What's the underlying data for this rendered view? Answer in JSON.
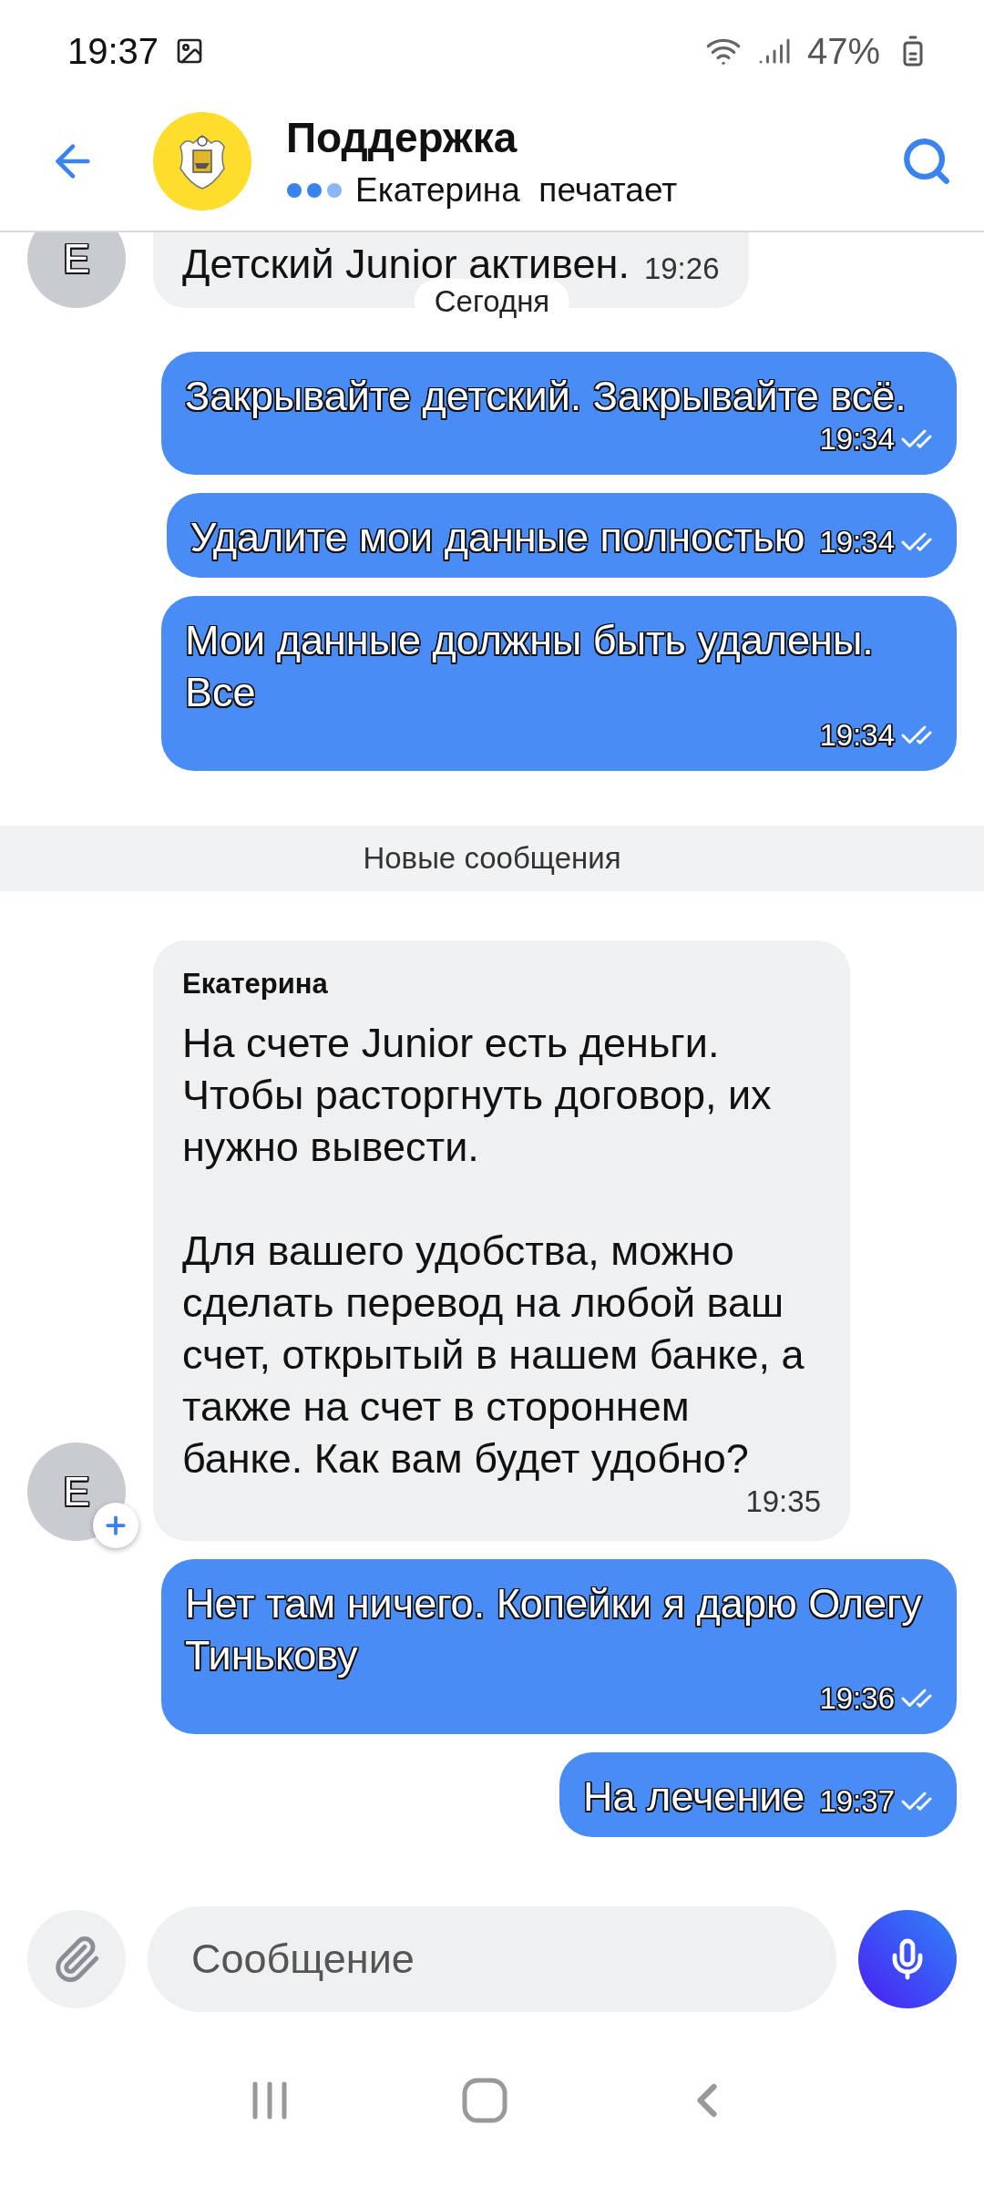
{
  "status_bar": {
    "time": "19:37",
    "battery": "47%"
  },
  "header": {
    "title": "Поддержка",
    "subtitle": "Екатерина  печатает"
  },
  "date_chip": "Сегодня",
  "messages": [
    {
      "kind": "incoming",
      "avatar": "Е",
      "text": "Детский Junior активен.",
      "time": "19:26"
    },
    {
      "kind": "outgoing",
      "text": "Закрывайте детский. Закрывайте всё.",
      "time": "19:34",
      "read": true
    },
    {
      "kind": "outgoing",
      "text": "Удалите мои данные полностью",
      "time": "19:34",
      "read": true
    },
    {
      "kind": "outgoing",
      "text": "Мои данные должны быть удалены. Все",
      "time": "19:34",
      "read": true
    },
    {
      "kind": "divider",
      "text": "Новые сообщения"
    },
    {
      "kind": "incoming",
      "avatar": "Е",
      "sender": "Екатерина",
      "paragraphs": [
        "На счете Junior есть деньги. Чтобы расторгнуть договор, их нужно вывести.",
        "Для вашего удобства, можно сделать перевод на любой ваш счет, открытый в нашем банке, а также на счет в стороннем банке. Как вам будет удобно?"
      ],
      "time": "19:35"
    },
    {
      "kind": "outgoing",
      "text": "Нет там ничего. Копейки я дарю Олегу Тинькову",
      "time": "19:36",
      "read": true
    },
    {
      "kind": "outgoing",
      "text": "На лечение",
      "time": "19:37",
      "read": true
    }
  ],
  "composer": {
    "placeholder": "Сообщение"
  }
}
